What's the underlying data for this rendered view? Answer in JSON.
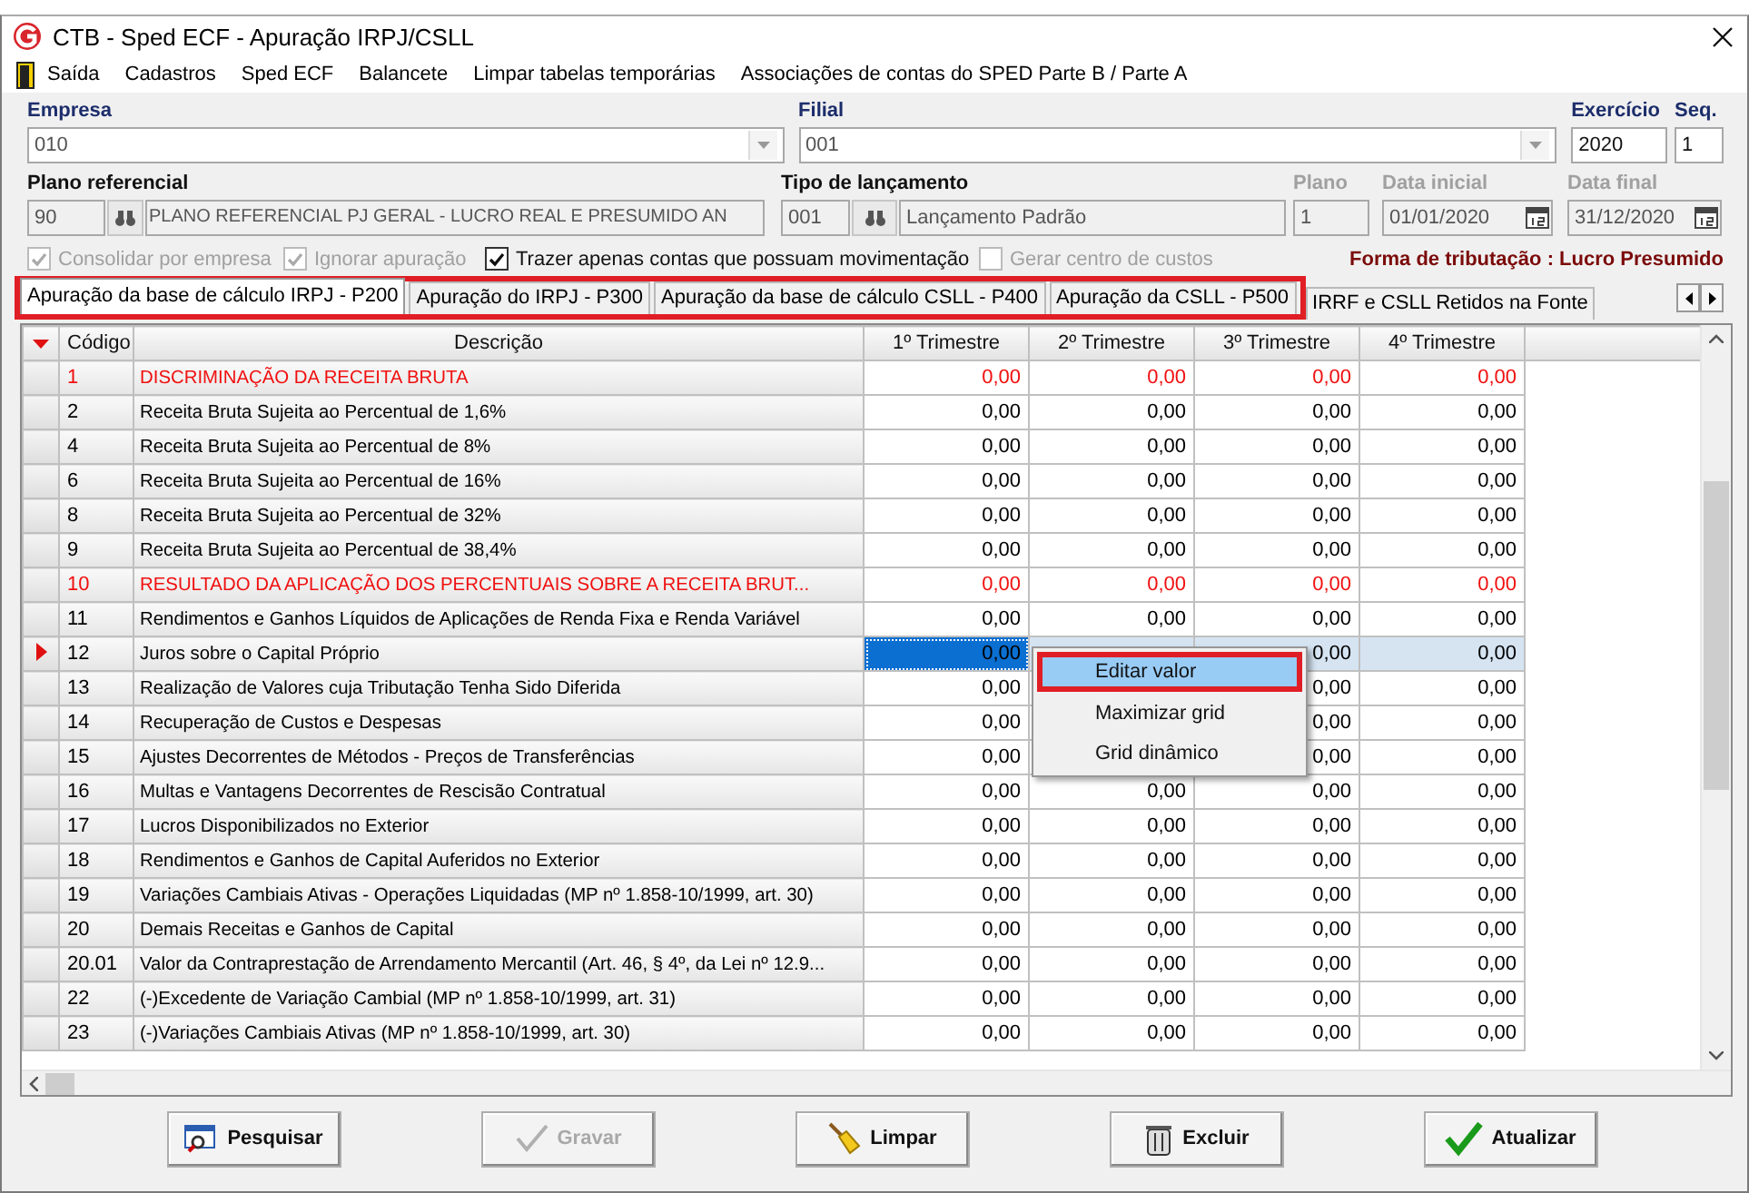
{
  "window": {
    "title": "CTB - Sped ECF - Apuração IRPJ/CSLL"
  },
  "menu": [
    {
      "label": "Saída"
    },
    {
      "label": "Cadastros"
    },
    {
      "label": "Sped ECF"
    },
    {
      "label": "Balancete"
    },
    {
      "label": "Limpar tabelas temporárias"
    },
    {
      "label": "Associações de contas do SPED Parte B / Parte A"
    }
  ],
  "form": {
    "empresa": {
      "label": "Empresa",
      "value": "010"
    },
    "filial": {
      "label": "Filial",
      "value": "001"
    },
    "exercicio": {
      "label": "Exercício",
      "value": "2020"
    },
    "seq": {
      "label": "Seq.",
      "value": "1"
    },
    "plano_referencial": {
      "label": "Plano referencial",
      "code": "90",
      "name": "PLANO REFERENCIAL PJ GERAL - LUCRO REAL E PRESUMIDO AN"
    },
    "tipo_lancamento": {
      "label": "Tipo de lançamento",
      "code": "001",
      "name": "Lançamento Padrão"
    },
    "plano": {
      "label": "Plano",
      "value": "1",
      "disabled": true
    },
    "data_inicial": {
      "label": "Data inicial",
      "value": "01/01/2020",
      "disabled": true
    },
    "data_final": {
      "label": "Data final",
      "value": "31/12/2020",
      "disabled": true
    },
    "options": [
      {
        "label": "Consolidar por empresa",
        "checked": true,
        "disabled": true
      },
      {
        "label": "Ignorar apuração",
        "checked": true,
        "disabled": true
      },
      {
        "label": "Trazer apenas contas que possuam movimentação",
        "checked": true,
        "disabled": false
      },
      {
        "label": "Gerar centro de custos",
        "checked": false,
        "disabled": true
      }
    ],
    "tributacao": "Forma de tributação : Lucro Presumido"
  },
  "tabs": [
    {
      "label": "Apuração da base de cálculo IRPJ - P200",
      "selected": true,
      "highlight": true
    },
    {
      "label": "Apuração do IRPJ - P300",
      "selected": false,
      "highlight": true
    },
    {
      "label": "Apuração da base de cálculo CSLL - P400",
      "selected": false,
      "highlight": true
    },
    {
      "label": "Apuração da CSLL - P500",
      "selected": false,
      "highlight": true
    },
    {
      "label": "IRRF e CSLL Retidos na Fonte",
      "selected": false,
      "highlight": false
    }
  ],
  "grid": {
    "columns": [
      "Código",
      "Descrição",
      "1º Trimestre",
      "2º Trimestre",
      "3º Trimestre",
      "4º Trimestre"
    ],
    "rows": [
      {
        "code": "1",
        "description": "DISCRIMINAÇÃO DA RECEITA BRUTA",
        "kind": "group",
        "current": false,
        "q1": "0,00",
        "q2": "0,00",
        "q3": "0,00",
        "q4": "0,00"
      },
      {
        "code": "2",
        "description": "Receita Bruta Sujeita ao Percentual de 1,6%",
        "kind": "item",
        "current": false,
        "q1": "0,00",
        "q2": "0,00",
        "q3": "0,00",
        "q4": "0,00"
      },
      {
        "code": "4",
        "description": "Receita Bruta Sujeita ao Percentual de 8%",
        "kind": "item",
        "current": false,
        "q1": "0,00",
        "q2": "0,00",
        "q3": "0,00",
        "q4": "0,00"
      },
      {
        "code": "6",
        "description": "Receita Bruta Sujeita ao Percentual de 16%",
        "kind": "item",
        "current": false,
        "q1": "0,00",
        "q2": "0,00",
        "q3": "0,00",
        "q4": "0,00"
      },
      {
        "code": "8",
        "description": "Receita Bruta Sujeita ao Percentual de 32%",
        "kind": "item",
        "current": false,
        "q1": "0,00",
        "q2": "0,00",
        "q3": "0,00",
        "q4": "0,00"
      },
      {
        "code": "9",
        "description": "Receita Bruta Sujeita ao Percentual de 38,4%",
        "kind": "item",
        "current": false,
        "q1": "0,00",
        "q2": "0,00",
        "q3": "0,00",
        "q4": "0,00"
      },
      {
        "code": "10",
        "description": "RESULTADO DA APLICAÇÃO DOS PERCENTUAIS SOBRE A RECEITA BRUT...",
        "kind": "group",
        "current": false,
        "q1": "0,00",
        "q2": "0,00",
        "q3": "0,00",
        "q4": "0,00"
      },
      {
        "code": "11",
        "description": "Rendimentos e Ganhos Líquidos de Aplicações de Renda Fixa e Renda Variável",
        "kind": "item",
        "current": false,
        "q1": "0,00",
        "q2": "0,00",
        "q3": "0,00",
        "q4": "0,00"
      },
      {
        "code": "12",
        "description": "Juros sobre o Capital Próprio",
        "kind": "item",
        "current": true,
        "q1": "0,00",
        "q3": "0,00",
        "q4": "0,00"
      },
      {
        "code": "13",
        "description": "Realização de Valores cuja Tributação Tenha Sido Diferida",
        "kind": "item",
        "current": false,
        "q1": "0,00",
        "q3": "0,00",
        "q4": "0,00"
      },
      {
        "code": "14",
        "description": "Recuperação de Custos e Despesas",
        "kind": "item",
        "current": false,
        "q1": "0,00",
        "q3": "0,00",
        "q4": "0,00"
      },
      {
        "code": "15",
        "description": "Ajustes Decorrentes de Métodos - Preços de Transferências",
        "kind": "item",
        "current": false,
        "q1": "0,00",
        "q3": "0,00",
        "q4": "0,00"
      },
      {
        "code": "16",
        "description": "Multas e Vantagens Decorrentes de Rescisão Contratual",
        "kind": "item",
        "current": false,
        "q1": "0,00",
        "q2": "0,00",
        "q3": "0,00",
        "q4": "0,00"
      },
      {
        "code": "17",
        "description": "Lucros Disponibilizados no Exterior",
        "kind": "item",
        "current": false,
        "q1": "0,00",
        "q2": "0,00",
        "q3": "0,00",
        "q4": "0,00"
      },
      {
        "code": "18",
        "description": "Rendimentos e Ganhos de Capital Auferidos no Exterior",
        "kind": "item",
        "current": false,
        "q1": "0,00",
        "q2": "0,00",
        "q3": "0,00",
        "q4": "0,00"
      },
      {
        "code": "19",
        "description": "Variações Cambiais Ativas - Operações Liquidadas (MP nº 1.858-10/1999, art. 30)",
        "kind": "item",
        "current": false,
        "q1": "0,00",
        "q2": "0,00",
        "q3": "0,00",
        "q4": "0,00"
      },
      {
        "code": "20",
        "description": "Demais Receitas e Ganhos de Capital",
        "kind": "item",
        "current": false,
        "q1": "0,00",
        "q2": "0,00",
        "q3": "0,00",
        "q4": "0,00"
      },
      {
        "code": "20.01",
        "description": "Valor da Contraprestação de Arrendamento Mercantil (Art. 46, § 4º, da Lei nº 12.9...",
        "kind": "item",
        "current": false,
        "q1": "0,00",
        "q2": "0,00",
        "q3": "0,00",
        "q4": "0,00"
      },
      {
        "code": "22",
        "description": "(-)Excedente de Variação Cambial (MP nº 1.858-10/1999, art. 31)",
        "kind": "item",
        "current": false,
        "q1": "0,00",
        "q2": "0,00",
        "q3": "0,00",
        "q4": "0,00"
      },
      {
        "code": "23",
        "description": "(-)Variações Cambiais Ativas (MP nº 1.858-10/1999, art. 30)",
        "kind": "item",
        "current": false,
        "q1": "0,00",
        "q2": "0,00",
        "q3": "0,00",
        "q4": "0,00"
      }
    ]
  },
  "context_menu": {
    "items": [
      {
        "label": "Editar valor",
        "selected": true,
        "highlight": true
      },
      {
        "label": "Maximizar grid",
        "selected": false,
        "highlight": false
      },
      {
        "label": "Grid dinâmico",
        "selected": false,
        "highlight": false
      }
    ]
  },
  "buttons": [
    {
      "label": "Pesquisar",
      "kind": "search",
      "disabled": false
    },
    {
      "label": "Gravar",
      "kind": "save",
      "disabled": true
    },
    {
      "label": "Limpar",
      "kind": "clear",
      "disabled": false
    },
    {
      "label": "Excluir",
      "kind": "delete",
      "disabled": false
    },
    {
      "label": "Atualizar",
      "kind": "refresh",
      "disabled": false
    }
  ]
}
